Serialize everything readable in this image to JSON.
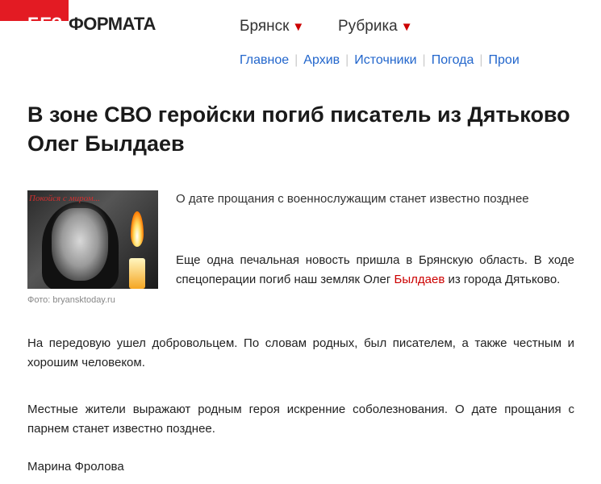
{
  "header": {
    "logo_prefix": "БЕЗ",
    "logo_rest": "ФОРМАТА",
    "city_label": "Брянск",
    "rubric_label": "Рубрика",
    "nav": [
      "Главное",
      "Архив",
      "Источники",
      "Погода",
      "Прои"
    ]
  },
  "article": {
    "title": "В зоне СВО геройски погиб писатель из Дятьково Олег Былдаев",
    "photo_overlay_text": "Покойся с миром...",
    "photo_credit": "Фото: bryansktoday.ru",
    "lead": "О дате прощания с военнослужащим станет известно позднее",
    "p2_before": "Еще одна печальная новость пришла в Брянскую область. В ходе спецоперации погиб наш земляк Олег ",
    "p2_link": "Былдаев",
    "p2_after": " из города Дятьково.",
    "p3": "На передовую ушел добровольцем. По словам родных, был писателем, а также честным и хорошим человеком.",
    "p4": "Местные жители выражают родным героя искренние соболезнования. О дате прощания с парнем станет известно позднее.",
    "author": "Марина Фролова"
  },
  "colors": {
    "brand_red": "#e31b23",
    "link_blue": "#2266cc"
  }
}
